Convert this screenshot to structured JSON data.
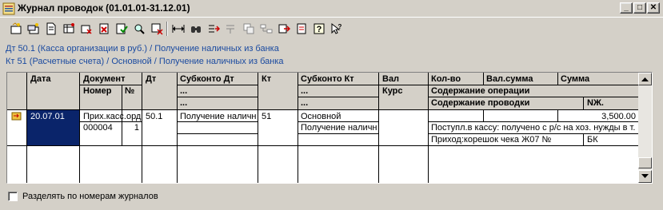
{
  "window": {
    "title": "Журнал проводок (01.01.01-31.12.01)",
    "minimize_glyph": "_",
    "maximize_glyph": "□",
    "close_glyph": "✕"
  },
  "toolbar": {
    "icons": [
      "new-icon",
      "new-copy-icon",
      "edit-icon",
      "table-icon",
      "delete-mark-icon",
      "delete-icon",
      "post-icon",
      "search-icon",
      "filter-off-icon",
      "interval-icon",
      "find-icon",
      "move-icon",
      "move-down-icon",
      "copy-entries-icon",
      "export-icon",
      "help-icon",
      "context-help-icon"
    ]
  },
  "info": {
    "debit_line": "Дт 50.1 (Касса организации в руб.) / Получение наличных из банка",
    "credit_line": "Кт 51 (Расчетные счета) / Основной / Получение наличных из банка"
  },
  "table": {
    "headers": {
      "date": "Дата",
      "document": "Документ",
      "number": "Номер",
      "num_sign": "№",
      "dt": "Дт",
      "subkonto_dt": "Субконто Дт",
      "subkonto_dt_2": "...",
      "subkonto_dt_3": "...",
      "kt": "Кт",
      "subkonto_kt": "Субконто Кт",
      "subkonto_kt_2": "...",
      "subkonto_kt_3": "...",
      "val": "Вал",
      "kurs": "Курс",
      "qty": "Кол-во",
      "val_sum": "Вал.сумма",
      "sum": "Сумма",
      "op_content": "Содержание операции",
      "entry_content": "Содержание проводки",
      "jn": "NЖ."
    },
    "row": {
      "date": "20.07.01",
      "document": "Прих.касс.орд",
      "number": "000004",
      "num": "1",
      "dt": "50.1",
      "subkonto_dt": "Получение наличн",
      "kt": "51",
      "subkonto_kt": "Основной",
      "subkonto_kt_2": "Получение наличн",
      "sum": "3,500.00",
      "op_content": "Поступл.в кассу: получено с р/с на хоз. нужды в т.",
      "entry_content": "Приход:корешок чека Ж07 №",
      "jn": "БК"
    }
  },
  "footer": {
    "checkbox_label": "Разделять по номерам журналов",
    "checked": false
  }
}
